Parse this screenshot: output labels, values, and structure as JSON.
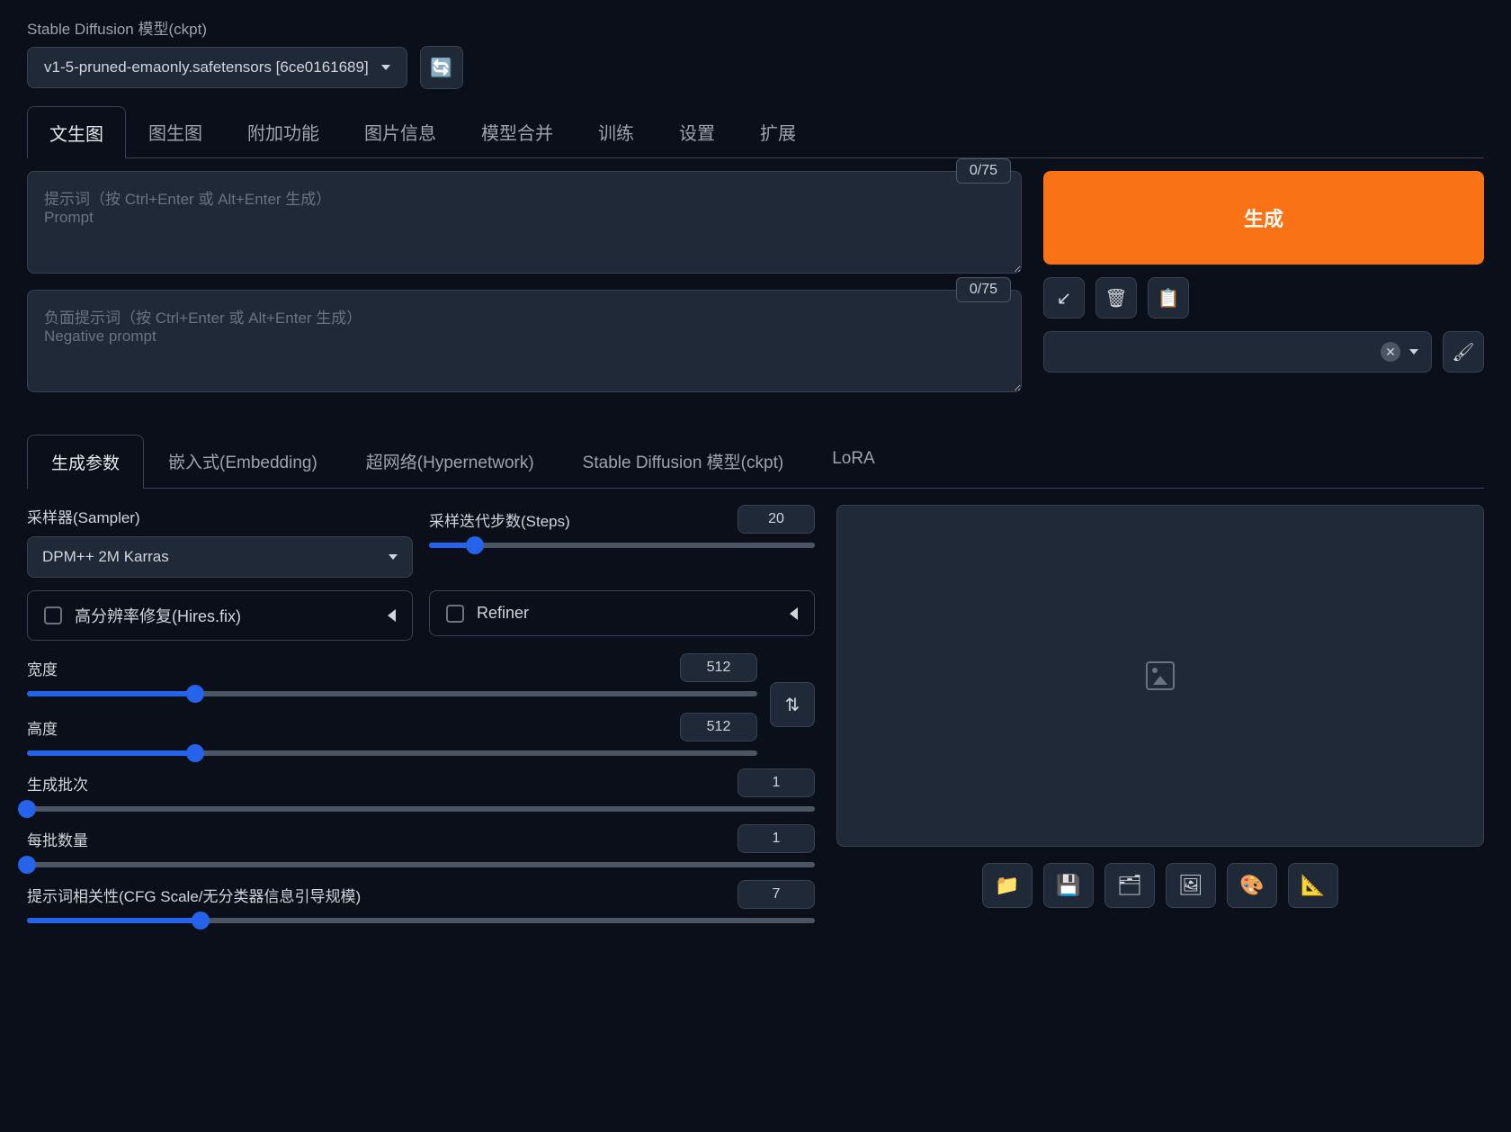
{
  "model": {
    "label": "Stable Diffusion 模型(ckpt)",
    "selected": "v1-5-pruned-emaonly.safetensors [6ce0161689]"
  },
  "tabs": [
    "文生图",
    "图生图",
    "附加功能",
    "图片信息",
    "模型合并",
    "训练",
    "设置",
    "扩展"
  ],
  "prompt": {
    "counter": "0/75",
    "placeholder": "提示词（按 Ctrl+Enter 或 Alt+Enter 生成）\nPrompt"
  },
  "neg_prompt": {
    "counter": "0/75",
    "placeholder": "负面提示词（按 Ctrl+Enter 或 Alt+Enter 生成）\nNegative prompt"
  },
  "generate_label": "生成",
  "subtabs": [
    "生成参数",
    "嵌入式(Embedding)",
    "超网络(Hypernetwork)",
    "Stable Diffusion 模型(ckpt)",
    "LoRA"
  ],
  "sampler": {
    "label": "采样器(Sampler)",
    "selected": "DPM++ 2M Karras"
  },
  "steps": {
    "label": "采样迭代步数(Steps)",
    "value": "20"
  },
  "hires": {
    "label": "高分辨率修复(Hires.fix)"
  },
  "refiner": {
    "label": "Refiner"
  },
  "width": {
    "label": "宽度",
    "value": "512"
  },
  "height": {
    "label": "高度",
    "value": "512"
  },
  "batch_count": {
    "label": "生成批次",
    "value": "1"
  },
  "batch_size": {
    "label": "每批数量",
    "value": "1"
  },
  "cfg": {
    "label": "提示词相关性(CFG Scale/无分类器信息引导规模)",
    "value": "7"
  },
  "icons": {
    "refresh": "🔄",
    "arrow_in": "↙",
    "trash": "🗑",
    "clipboard": "📋",
    "brush": "🖌",
    "swap": "⇅",
    "folder": "📁",
    "save": "💾",
    "zip": "🗂",
    "image": "🖼",
    "palette": "🎨",
    "ruler": "📐"
  }
}
